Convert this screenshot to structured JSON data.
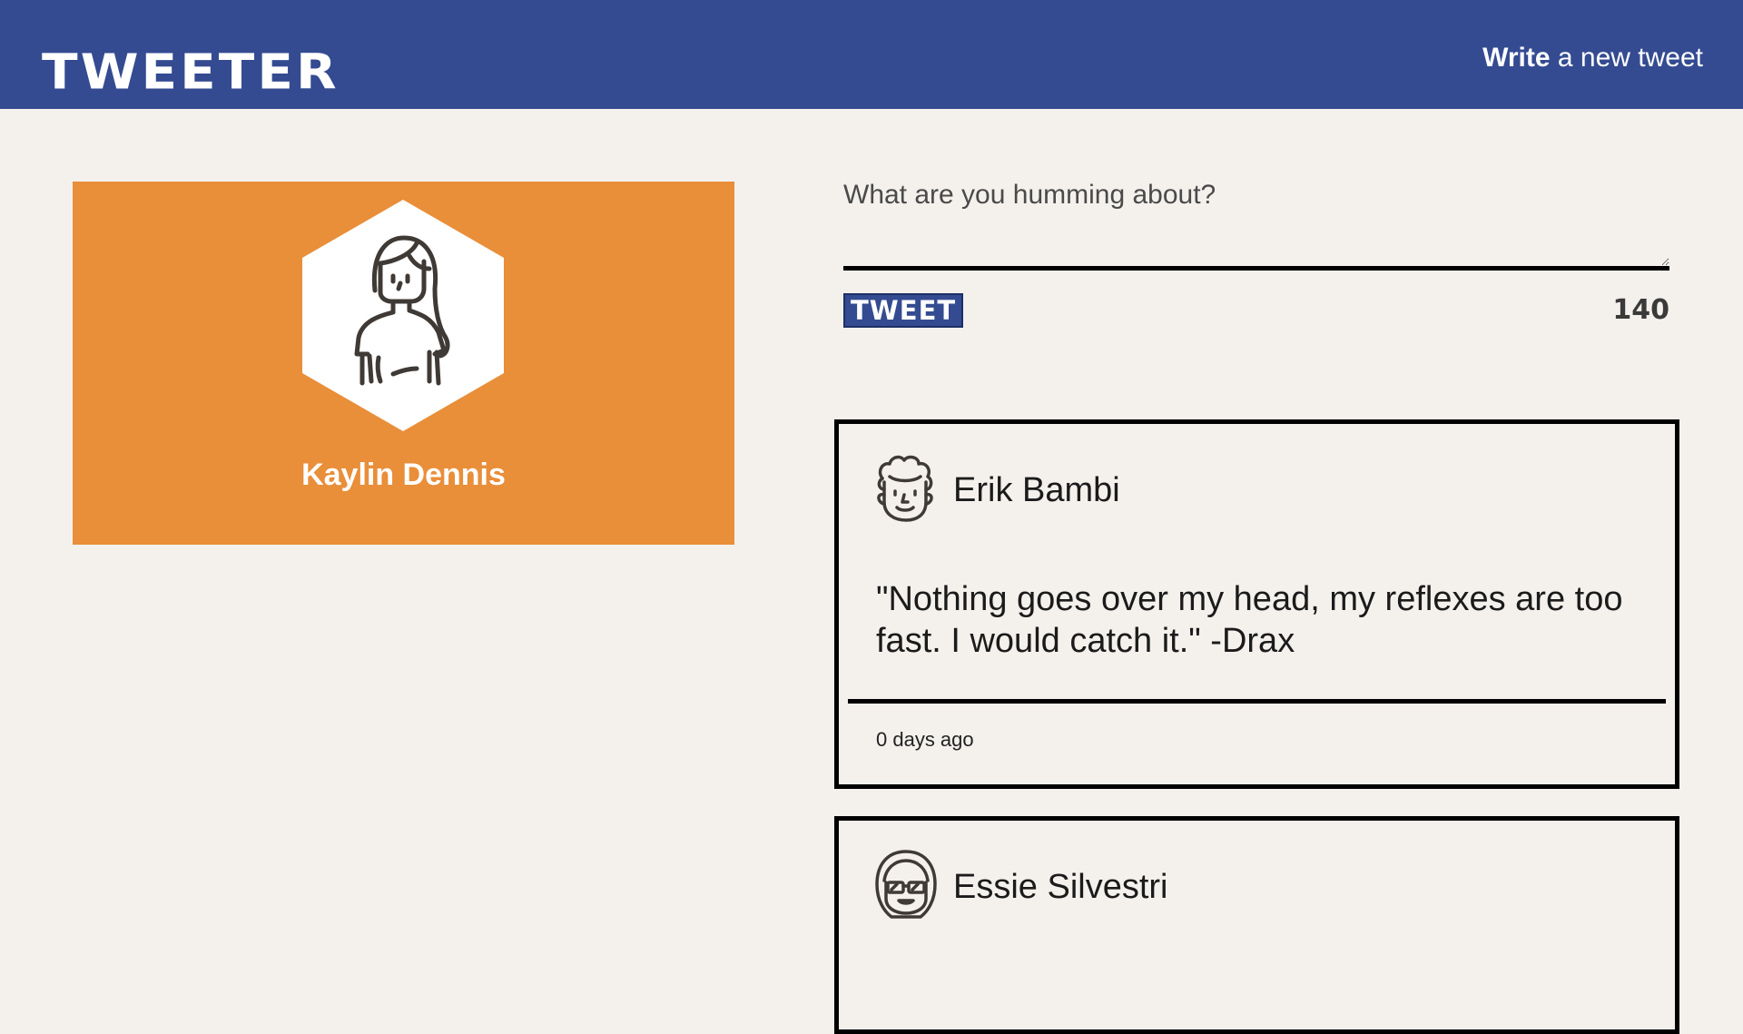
{
  "nav": {
    "brand": "TWEETER",
    "compose_strong": "Write",
    "compose_rest": " a new tweet"
  },
  "profile": {
    "name": "Kaylin Dennis",
    "avatar_icon": "woman-avatar-icon",
    "card_color": "#e98e39"
  },
  "composer": {
    "placeholder": "What are you humming about?",
    "button_label": "TWEET",
    "counter": "140"
  },
  "tweets": [
    {
      "author": "Erik Bambi",
      "avatar_icon": "curly-hair-man-avatar-icon",
      "text": "\"Nothing goes over my head, my reflexes are too fast. I would catch it.\" -Drax",
      "time": "0 days ago"
    },
    {
      "author": "Essie Silvestri",
      "avatar_icon": "sunglasses-avatar-icon"
    }
  ],
  "colors": {
    "nav": "#344b91",
    "background": "#f4f1ed",
    "accent": "#e98e39"
  }
}
